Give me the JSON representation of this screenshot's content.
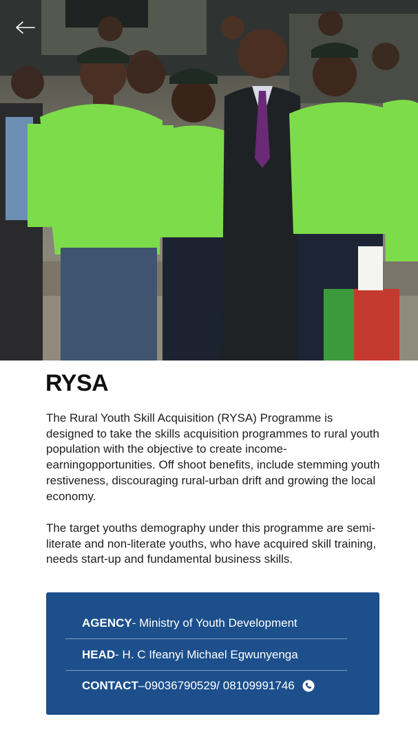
{
  "colors": {
    "card_background": "#1c4f8c",
    "tshirt_green": "#7ddc4a",
    "text": "#1d1d1d"
  },
  "icons": {
    "back": "arrow-left-icon",
    "phone": "phone-icon"
  },
  "header": {
    "title": "RYSA"
  },
  "body": {
    "paragraph_1": "The Rural Youth Skill Acquisition (RYSA) Programme is designed to take the  skills acquisition programmes to rural youth population with the objective to create income-earningopportunities.  Off shoot benefits, include stemming youth restiveness, discouraging rural-urban drift and growing the local economy.",
    "paragraph_2": "The target youths demography under this programme are semi-literate and non-literate youths, who have acquired skill training, needs start-up and fundamental business skills."
  },
  "info": {
    "agency_label": "AGENCY",
    "agency_value": " - Ministry of Youth Development",
    "head_label": "HEAD",
    "head_value": " - H. C Ifeanyi Michael Egwunyenga",
    "contact_label": "CONTACT",
    "contact_value": " –09036790529/ 08109991746"
  }
}
